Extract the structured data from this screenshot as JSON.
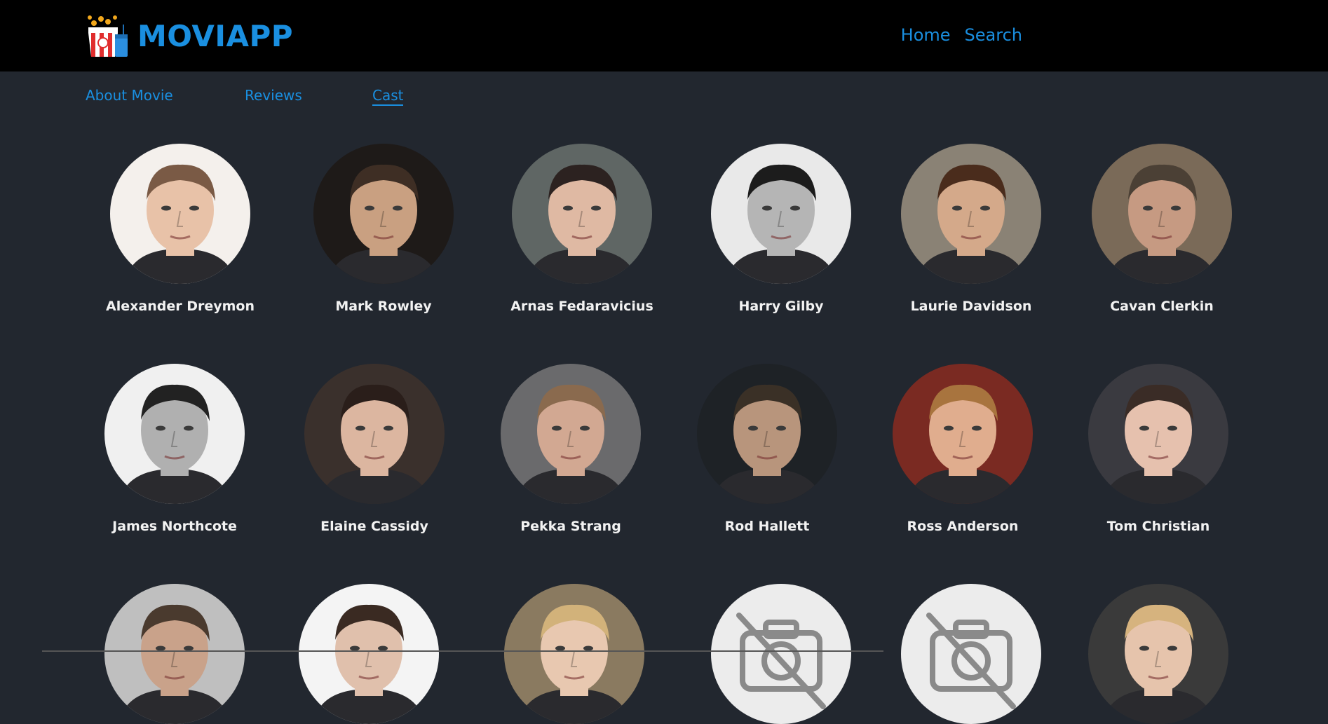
{
  "brand": {
    "name": "MOVIAPP",
    "logo_icon": "popcorn-icon",
    "accent": "#1a8fe0"
  },
  "nav": [
    {
      "label": "Home"
    },
    {
      "label": "Search"
    }
  ],
  "tabs": [
    {
      "label": "About Movie",
      "active": false
    },
    {
      "label": "Reviews",
      "active": false
    },
    {
      "label": "Cast",
      "active": true
    }
  ],
  "cast": [
    {
      "name": "Alexander Dreymon",
      "skin": "#e8c2a8",
      "hair": "#7a5a45",
      "bg": "#f4f0ec"
    },
    {
      "name": "Mark Rowley",
      "skin": "#c9a081",
      "hair": "#3e2e24",
      "bg": "#1e1a18"
    },
    {
      "name": "Arnas Fedaravicius",
      "skin": "#dfb9a3",
      "hair": "#2c2220",
      "bg": "#5f6664"
    },
    {
      "name": "Harry Gilby",
      "skin": "#b5b5b5",
      "hair": "#1c1c1c",
      "bg": "#e9e9e9"
    },
    {
      "name": "Laurie Davidson",
      "skin": "#d4a98a",
      "hair": "#4a2c1c",
      "bg": "#8a8275"
    },
    {
      "name": "Cavan Clerkin",
      "skin": "#c69a82",
      "hair": "#4b4035",
      "bg": "#7a6a58"
    },
    {
      "name": "James Northcote",
      "skin": "#b0b0b0",
      "hair": "#222222",
      "bg": "#f0f0f0"
    },
    {
      "name": "Elaine Cassidy",
      "skin": "#dcb6a0",
      "hair": "#2a1e1a",
      "bg": "#3a302c"
    },
    {
      "name": "Pekka Strang",
      "skin": "#d2a892",
      "hair": "#8a6a4e",
      "bg": "#6a6a6c"
    },
    {
      "name": "Rod Hallett",
      "skin": "#b8957c",
      "hair": "#3a3026",
      "bg": "#1e2226"
    },
    {
      "name": "Ross Anderson",
      "skin": "#e0ad8e",
      "hair": "#a8743e",
      "bg": "#7a2a22"
    },
    {
      "name": "Tom Christian",
      "skin": "#e6c1ae",
      "hair": "#3a2c26",
      "bg": "#3a3a40"
    },
    {
      "name": "",
      "skin": "#c9a28a",
      "hair": "#4a3a2e",
      "bg": "#bfbfbf"
    },
    {
      "name": "",
      "skin": "#e0c0ac",
      "hair": "#3a2a22",
      "bg": "#f4f4f4"
    },
    {
      "name": "",
      "skin": "#e8c8b0",
      "hair": "#d2b27a",
      "bg": "#8a7a60"
    },
    {
      "name": "",
      "placeholder": true,
      "icon": "no-camera-icon"
    },
    {
      "name": "",
      "placeholder": true,
      "icon": "no-camera-icon"
    },
    {
      "name": "",
      "skin": "#e6c4ac",
      "hair": "#d6b37e",
      "bg": "#3a3a3a"
    }
  ]
}
